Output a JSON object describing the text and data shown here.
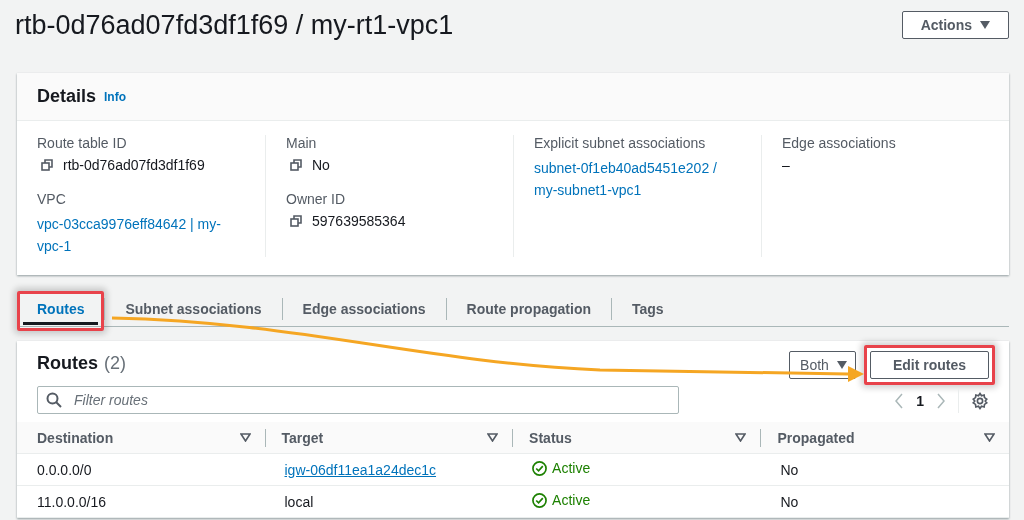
{
  "page": {
    "title": "rtb-0d76ad07fd3df1f69 / my-rt1-vpc1",
    "actions_button": "Actions"
  },
  "details": {
    "title": "Details",
    "info": "Info",
    "columns": [
      {
        "fields": [
          {
            "label": "Route table ID",
            "value": "rtb-0d76ad07fd3df1f69",
            "kind": "copy"
          },
          {
            "label": "VPC",
            "value": "vpc-03cca9976eff84642 | my-vpc-1",
            "kind": "link"
          }
        ]
      },
      {
        "fields": [
          {
            "label": "Main",
            "value": "No",
            "kind": "copy"
          },
          {
            "label": "Owner ID",
            "value": "597639585364",
            "kind": "copy"
          }
        ]
      },
      {
        "fields": [
          {
            "label": "Explicit subnet associations",
            "value": "subnet-0f1eb40ad5451e202 / my-subnet1-vpc1",
            "kind": "link"
          }
        ]
      },
      {
        "fields": [
          {
            "label": "Edge associations",
            "value": "–",
            "kind": "text"
          }
        ]
      }
    ]
  },
  "tabs": [
    {
      "label": "Routes",
      "selected": true,
      "highlighted": true
    },
    {
      "label": "Subnet associations",
      "selected": false,
      "highlighted": false
    },
    {
      "label": "Edge associations",
      "selected": false,
      "highlighted": false
    },
    {
      "label": "Route propagation",
      "selected": false,
      "highlighted": false
    },
    {
      "label": "Tags",
      "selected": false,
      "highlighted": false
    }
  ],
  "routes": {
    "title": "Routes",
    "count": "(2)",
    "filter": {
      "placeholder": "Filter routes"
    },
    "both_button": "Both",
    "edit_button": {
      "label": "Edit routes",
      "highlighted": true
    },
    "page": "1",
    "columns": [
      "Destination",
      "Target",
      "Status",
      "Propagated"
    ],
    "rows": [
      {
        "destination": "0.0.0.0/0",
        "target": {
          "text": "igw-06df11ea1a24dec1c",
          "kind": "link"
        },
        "status": "Active",
        "propagated": "No"
      },
      {
        "destination": "11.0.0.0/16",
        "target": {
          "text": "local",
          "kind": "text"
        },
        "status": "Active",
        "propagated": "No"
      }
    ]
  }
}
